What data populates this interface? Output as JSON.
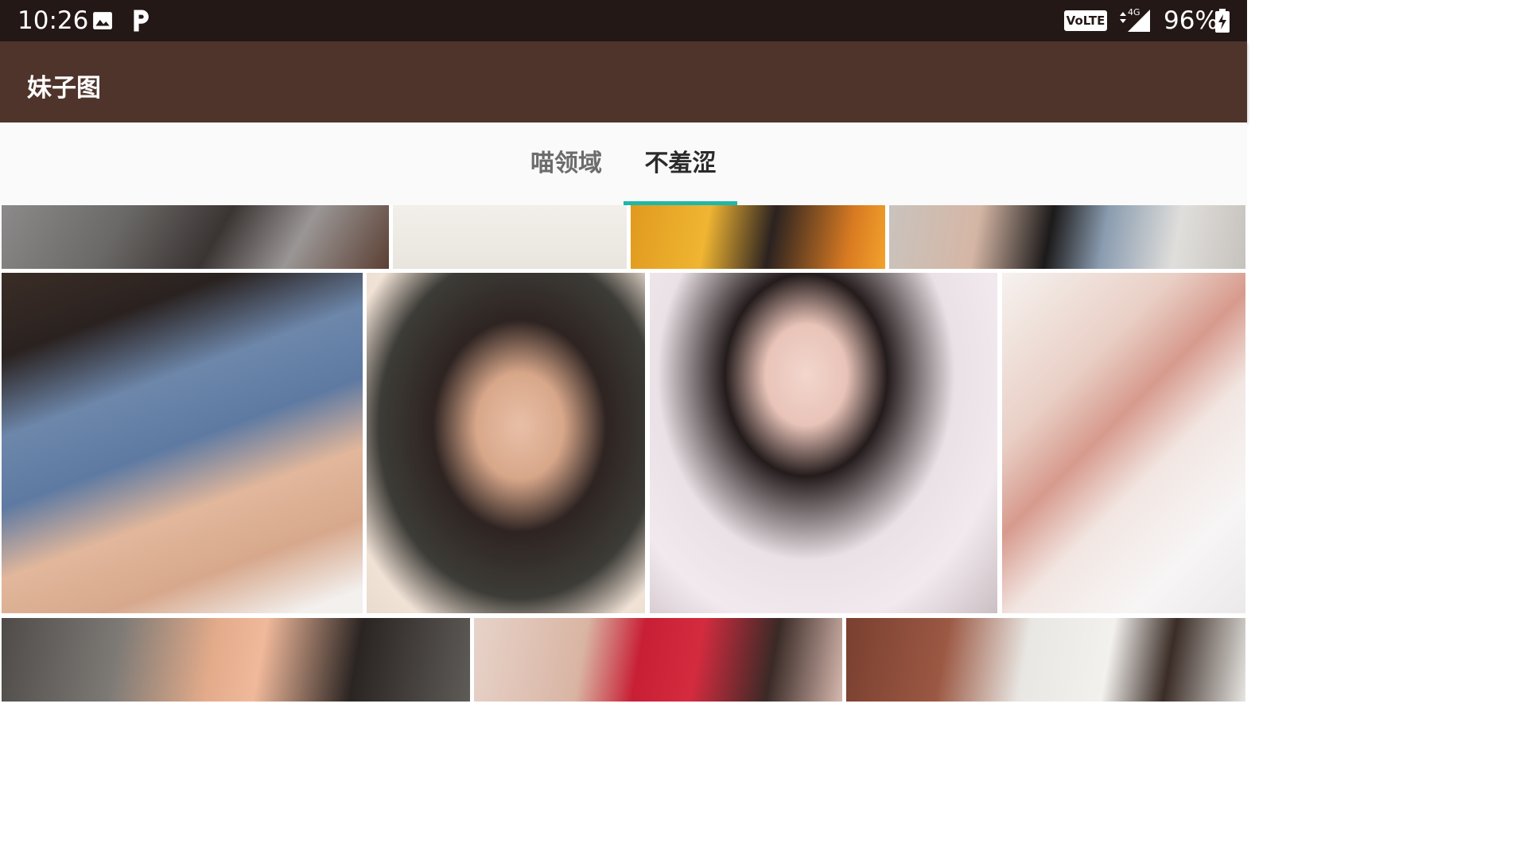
{
  "status_bar": {
    "time": "10:26",
    "icons": [
      "image-icon",
      "p-icon",
      "volte-icon",
      "signal-4g-icon",
      "battery-icon"
    ],
    "volte_label": "VoLTE",
    "network_label": "4G",
    "battery": "96%"
  },
  "app_bar": {
    "title": "妹子图"
  },
  "tabs": [
    {
      "label": "喵领域",
      "selected": false
    },
    {
      "label": "不羞涩",
      "selected": true
    }
  ],
  "colors": {
    "status_bar": "#231816",
    "app_bar": "#4e342b",
    "tab_indicator": "#1fb7a8"
  },
  "grid": {
    "rows": 3,
    "photos_visible": 11
  }
}
